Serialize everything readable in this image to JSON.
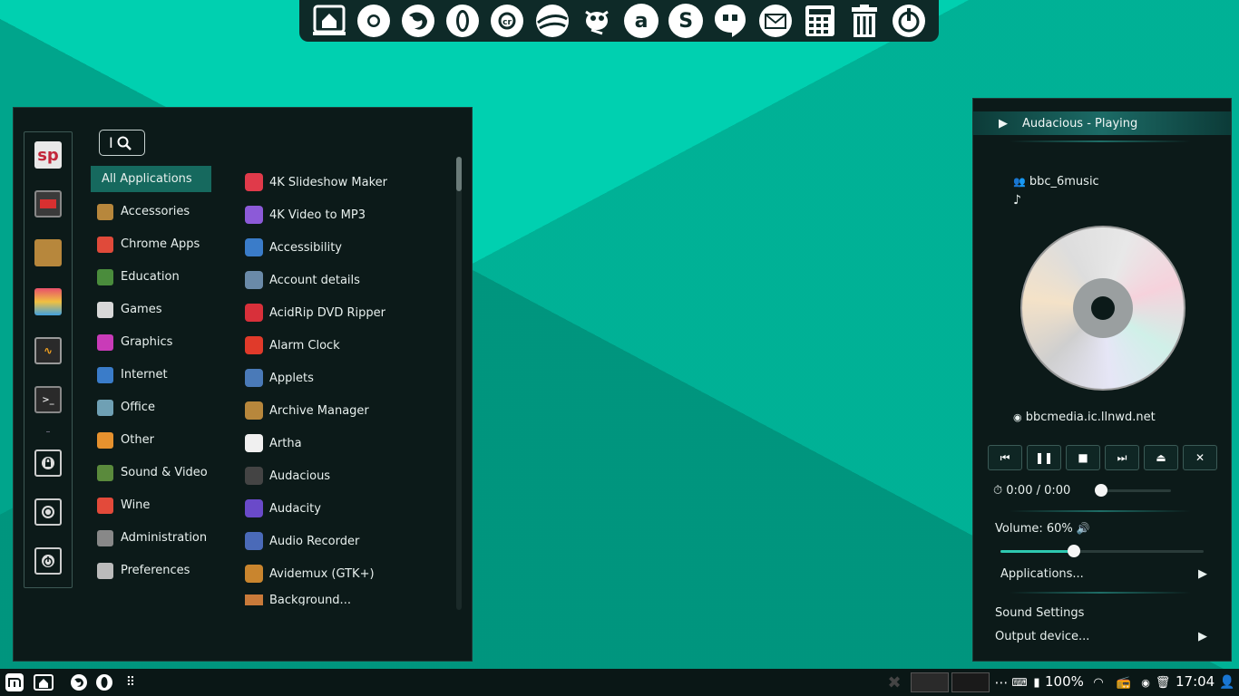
{
  "dock": {
    "icons": [
      "home-icon",
      "chrome-icon",
      "firefox-icon",
      "opera-icon",
      "chromium-icon",
      "google-earth-icon",
      "gimp-icon",
      "audacious-icon",
      "skype-icon",
      "hangouts-icon",
      "mail-icon",
      "calculator-icon",
      "trash-icon",
      "power-icon"
    ]
  },
  "menu": {
    "categories": [
      {
        "label": "All Applications",
        "color": "#16695e"
      },
      {
        "label": "Accessories",
        "color": "#b7873c"
      },
      {
        "label": "Chrome Apps",
        "color": "#e04a3a"
      },
      {
        "label": "Education",
        "color": "#4a8c3c"
      },
      {
        "label": "Games",
        "color": "#d8d8d8"
      },
      {
        "label": "Graphics",
        "color": "#c93bb8"
      },
      {
        "label": "Internet",
        "color": "#3a7cc9"
      },
      {
        "label": "Office",
        "color": "#6fa0b4"
      },
      {
        "label": "Other",
        "color": "#e6912e"
      },
      {
        "label": "Sound & Video",
        "color": "#5a8a3c"
      },
      {
        "label": "Wine",
        "color": "#e34a3a"
      },
      {
        "label": "Administration",
        "color": "#888"
      },
      {
        "label": "Preferences",
        "color": "#bbb"
      }
    ],
    "apps": [
      {
        "label": "4K Slideshow Maker",
        "color": "#e03a4a"
      },
      {
        "label": "4K Video to MP3",
        "color": "#8c5ad8"
      },
      {
        "label": "Accessibility",
        "color": "#3a7cc9"
      },
      {
        "label": "Account details",
        "color": "#6a8aa8"
      },
      {
        "label": "AcidRip DVD Ripper",
        "color": "#d8303a"
      },
      {
        "label": "Alarm Clock",
        "color": "#e03a2a"
      },
      {
        "label": "Applets",
        "color": "#4a7ab8"
      },
      {
        "label": "Archive Manager",
        "color": "#b7873c"
      },
      {
        "label": "Artha",
        "color": "#f0f0f0"
      },
      {
        "label": "Audacious",
        "color": "#444"
      },
      {
        "label": "Audacity",
        "color": "#6a4ac9"
      },
      {
        "label": "Audio Recorder",
        "color": "#4a6ab8"
      },
      {
        "label": "Avidemux (GTK+)",
        "color": "#c9852e"
      },
      {
        "label": "Background...",
        "color": "#c97a3a"
      }
    ]
  },
  "sound": {
    "header": "Audacious - Playing",
    "artist": "bbc_6music",
    "url": "bbcmedia.ic.llnwd.net",
    "time": "0:00 / 0:00",
    "volume_label": "Volume: 60%",
    "volume": 0.6,
    "applications": "Applications...",
    "sound_settings": "Sound Settings",
    "output_device": "Output device..."
  },
  "panel": {
    "battery": "100%",
    "clock": "17:04"
  }
}
